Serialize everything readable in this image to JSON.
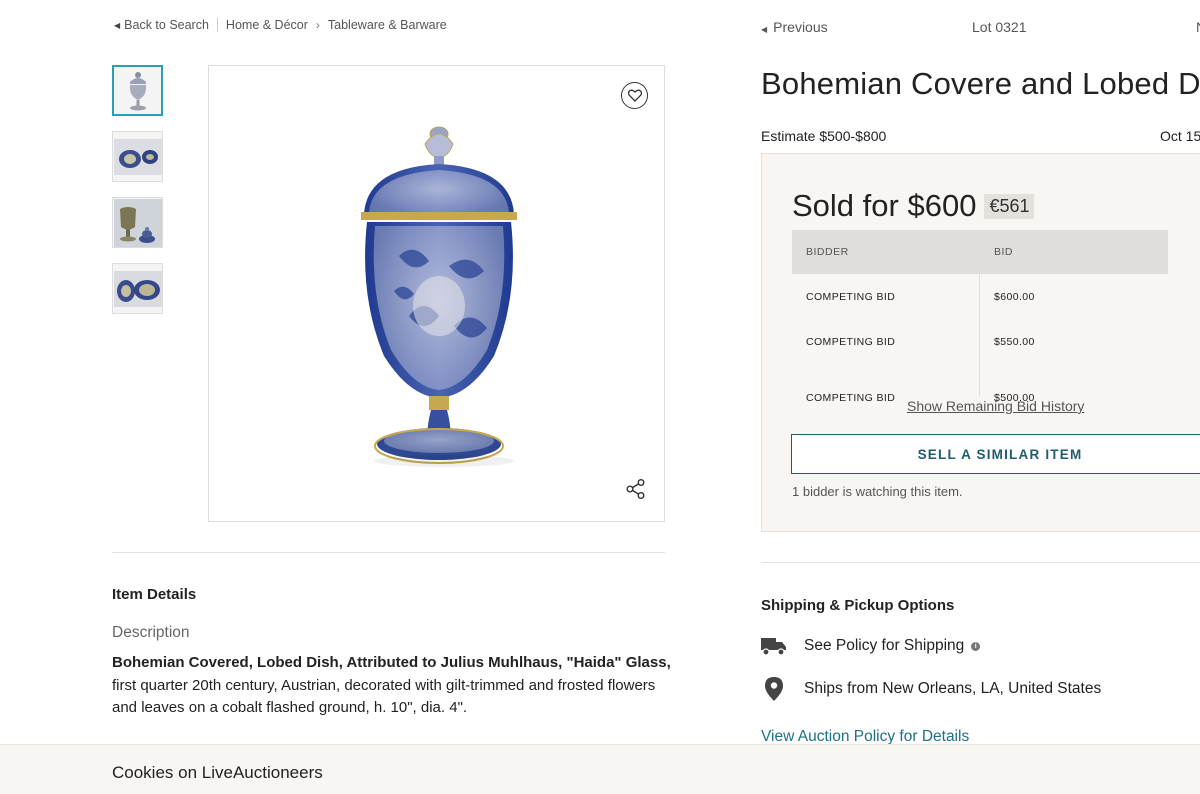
{
  "breadcrumb": {
    "back_label": "Back to Search",
    "items": [
      "Home & Décor",
      "Tableware & Barware"
    ]
  },
  "lot_nav": {
    "previous_label": "Previous",
    "lot_number": "Lot 0321",
    "next_label": "N"
  },
  "thumbnails": [
    {
      "alt": "covered dish front"
    },
    {
      "alt": "dish and lid"
    },
    {
      "alt": "dish with lid beside"
    },
    {
      "alt": "dish detail"
    }
  ],
  "item": {
    "title": "Bohemian Covere and Lobed Dish",
    "estimate": "Estimate $500-$800",
    "date": "Oct 15"
  },
  "sale": {
    "sold_label": "Sold for",
    "price": "$600",
    "price_eur": "€561",
    "bid_headers": [
      "BIDDER",
      "BID"
    ],
    "bids": [
      {
        "bidder": "COMPETING BID",
        "bid": "$600.00"
      },
      {
        "bidder": "COMPETING BID",
        "bid": "$550.00"
      },
      {
        "bidder": "COMPETING BID",
        "bid": "$500.00"
      }
    ],
    "show_history_label": "Show Remaining Bid History",
    "sell_similar_label": "SELL A SIMILAR ITEM",
    "watchers_text": "1 bidder is watching this item."
  },
  "details": {
    "heading": "Item Details",
    "description_label": "Description",
    "description_bold": "Bohemian Covered, Lobed Dish, Attributed to Julius Muhlhaus, \"Haida\" Glass,",
    "description_rest": " first quarter 20th century, Austrian, decorated with gilt-trimmed and frosted flowers and leaves on a cobalt flashed ground, h. 10\", dia. 4\"."
  },
  "shipping": {
    "heading": "Shipping & Pickup Options",
    "policy_text": "See Policy for Shipping",
    "location_text": "Ships from New Orleans, LA, United States",
    "auction_policy_link": "View Auction Policy for Details"
  },
  "cookie": {
    "text": "Cookies on LiveAuctioneers"
  },
  "colors": {
    "accent": "#1f5d6e",
    "link": "#1f6f86",
    "thumb_active": "#2a9fbc",
    "panel_bg": "#f9f5f2"
  }
}
